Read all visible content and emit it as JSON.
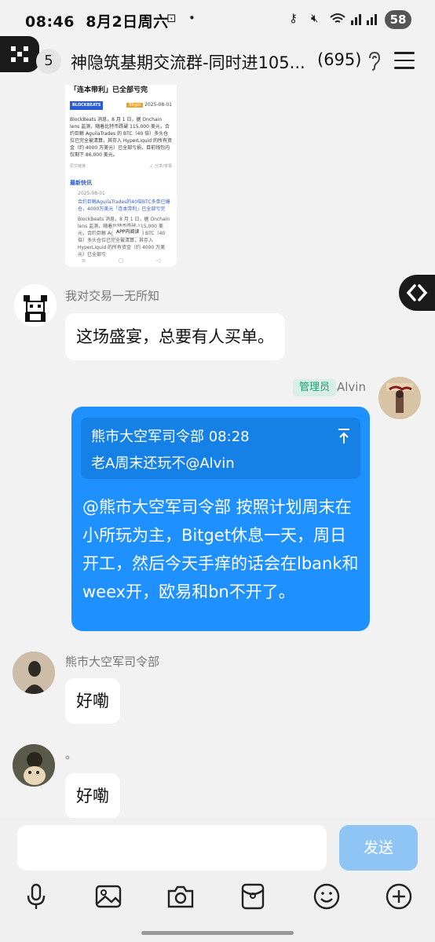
{
  "status_bar": {
    "time": "08:46",
    "date": "8月2日周六",
    "battery": "58"
  },
  "header": {
    "unread_count": "5",
    "title": "神隐筑基期交流群-同时进105...",
    "member_count": "(695)"
  },
  "image_message": {
    "title": "「连本带利」已全部亏完",
    "logo": "BLOCKBEATS",
    "tag": "Bitget",
    "date": "2025-08-01",
    "body": "BlockBeats 消息，8 月 1 日，据 Onchain lens 监测，随着比特币跌破 115,000 美元，合约巨鲸 AguilaTrades 的 BTC（40 倍）多头仓位已完全被清算，其存入 HyperLiquid 的所有资金（约 4000 万美元）已全部亏损，目前钱包内仅剩下 86,000 美元。",
    "foot_left": "原文链接",
    "foot_right": "ㄥ 分享/举报",
    "section": "最新快讯",
    "news_date": "2025-08-01",
    "news_title": "合约巨鲸AguilaTrades的40倍BTC多单已爆仓，4000万美元「连本带利」已全部亏完",
    "news_body": "BlockBeats 消息，8 月 1 日，据 Onchain lens 监测，随着比特币跌破 115,000 美元，合约巨鲸 AguilaTrades 的 BTC（40 倍）多头仓位已完全被清算，其存入 HyperLiquid 的所有资金（约 4000 万美元）已全部亏",
    "app_chip": "APP内阅读"
  },
  "messages": [
    {
      "sender": "我对交易一无所知",
      "text": "这场盛宴，总要有人买单。"
    },
    {
      "sender": "Alvin",
      "badge": "管理员",
      "quote_author": "熊市大空军司令部 08:28",
      "quote_text": "老A周末还玩不@Alvin",
      "text": "@熊市大空军司令部 按照计划周末在小所玩为主，Bitget休息一天，周日开工，然后今天手痒的话会在lbank和weex开，欧易和bn不开了。"
    },
    {
      "sender": "熊市大空军司令部",
      "text": "好嘞"
    },
    {
      "sender": "。",
      "text": "好嘞"
    }
  ],
  "input": {
    "value": "",
    "send_label": "发送"
  },
  "colors": {
    "accent": "#1e90ff",
    "send_disabled": "#8fc5f5",
    "admin_badge": "#1d9c73"
  },
  "toolbar_icons": [
    "mic-icon",
    "image-icon",
    "camera-icon",
    "red-packet-icon",
    "emoji-icon",
    "plus-icon"
  ]
}
